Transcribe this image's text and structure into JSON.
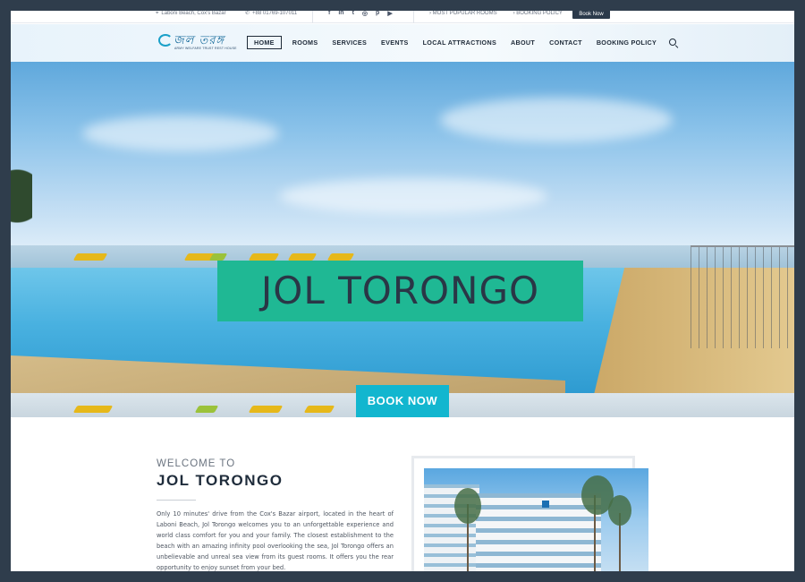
{
  "topbar": {
    "location": "Laboni Beach, Cox's Bazar",
    "phone": "+88 01769-107011",
    "social_icons": [
      "facebook-icon",
      "linkedin-icon",
      "twitter-icon",
      "instagram-icon",
      "pinterest-icon",
      "youtube-icon"
    ],
    "link_rooms": "MOST POPULAR ROOMS",
    "link_policy": "BOOKING POLICY",
    "book_label": "Book Now"
  },
  "header": {
    "logo_text": "জল তরঙ্গ",
    "logo_sub": "ARMY WELFARE TRUST REST HOUSE",
    "nav": [
      {
        "label": "HOME",
        "active": true
      },
      {
        "label": "ROOMS"
      },
      {
        "label": "SERVICES"
      },
      {
        "label": "EVENTS"
      },
      {
        "label": "LOCAL ATTRACTIONS"
      },
      {
        "label": "ABOUT"
      },
      {
        "label": "CONTACT"
      },
      {
        "label": "BOOKING POLICY"
      }
    ]
  },
  "hero": {
    "title": "JOL TORONGO",
    "cta": "BOOK NOW"
  },
  "welcome": {
    "subtitle": "WELCOME TO",
    "title": "JOL TORONGO",
    "body": "Only 10 minutes' drive from the Cox's Bazar airport, located in the heart of Laboni Beach, Jol Torongo welcomes you to an unforgettable experience and world class comfort for you and your family. The closest establishment to the beach with an amazing infinity pool overlooking the sea, Jol Torongo offers an unbelievable and unreal sea view from its guest rooms. It offers you the rear opportunity to enjoy sunset from your bed."
  },
  "colors": {
    "accent_green": "#1fb894",
    "accent_cyan": "#12b6cf",
    "dark": "#2b3a4b"
  }
}
